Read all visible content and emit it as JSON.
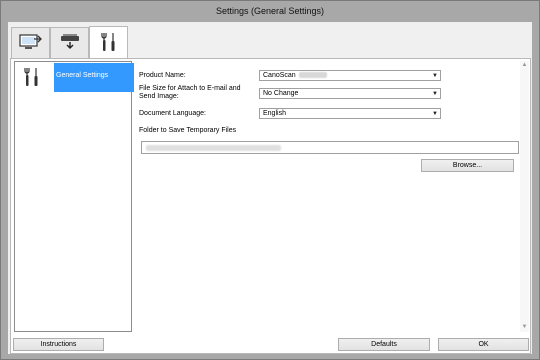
{
  "window": {
    "title": "Settings (General Settings)"
  },
  "tabs": [
    {
      "icon": "scan-to-computer-icon",
      "active": false
    },
    {
      "icon": "scanner-download-icon",
      "active": false
    },
    {
      "icon": "tools-icon",
      "active": true
    }
  ],
  "sidebar": {
    "items": [
      {
        "label": "General Settings",
        "icon": "tools-icon",
        "selected": true
      }
    ]
  },
  "form": {
    "product_name": {
      "label": "Product Name:",
      "value": "CanoScan"
    },
    "file_size": {
      "label": "File Size for Attach to E-mail and Send Image:",
      "value": "No Change"
    },
    "document_language": {
      "label": "Document Language:",
      "value": "English"
    },
    "temp_folder": {
      "label": "Folder to Save Temporary Files"
    },
    "browse_label": "Browse..."
  },
  "footer": {
    "instructions_label": "Instructions",
    "defaults_label": "Defaults",
    "ok_label": "OK"
  },
  "colors": {
    "selection": "#3399ff",
    "frame": "#a8a8a8",
    "client": "#f0f0f0"
  }
}
